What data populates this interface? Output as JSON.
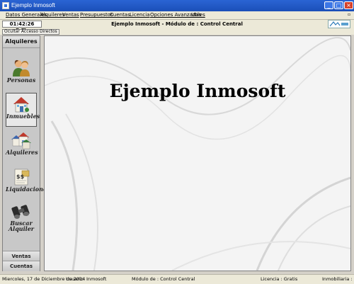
{
  "window": {
    "title": "Ejemplo Inmosoft",
    "controls": {
      "minimize": "_",
      "maximize": "□",
      "close": "×"
    }
  },
  "menu": [
    "Datos Generales",
    "Alquileres",
    "Ventas",
    "Presupuestos",
    "Cuentas",
    "Licencia",
    "Opciones Avanzadas",
    "Utiles"
  ],
  "infobar": {
    "clock": "01:42:26 p.m.",
    "window_title": "Ejemplo Inmosoft - Módulo de : Control Central",
    "logo": "logo-icon"
  },
  "toolbar": {
    "hide_shortcuts": "Ocultar Accesso Directos"
  },
  "sidebar": {
    "header": "Alquileres",
    "items": [
      {
        "label": "Personas",
        "icon": "people-icon"
      },
      {
        "label": "Inmuebles",
        "icon": "house-icon"
      },
      {
        "label": "Alquileres",
        "icon": "buildings-icon"
      },
      {
        "label": "Liquidaciones",
        "icon": "invoice-icon"
      },
      {
        "label": "Buscar",
        "label2": "Alquiler",
        "icon": "binoculars-icon"
      }
    ],
    "footer": [
      "Ventas",
      "Cuentas"
    ]
  },
  "main": {
    "heading": "Ejemplo Inmosoft"
  },
  "status": {
    "date": "Miercoles, 17 de Diciembre de 2014",
    "user": "Usuario: Inmosoft",
    "module": "Módulo de : Control Central",
    "license": "Licencia : Gratis",
    "company": "Inmobiliaria : Ej"
  },
  "colors": {
    "titlebar": "#1b4fb8",
    "chrome": "#ece9d8",
    "sidebar": "#c8c8c8",
    "main_bg": "#f4f4f4"
  }
}
